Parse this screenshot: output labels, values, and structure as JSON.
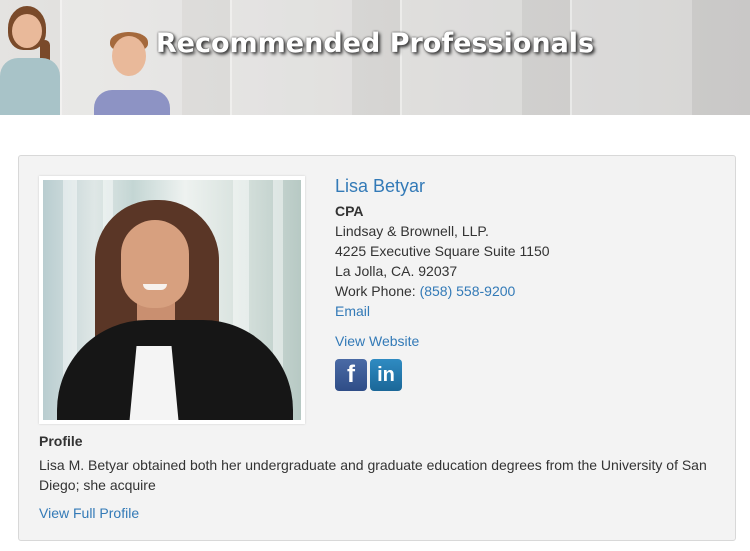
{
  "banner": {
    "title": "Recommended Professionals"
  },
  "professional": {
    "name": "Lisa Betyar",
    "designation": "CPA",
    "company": "Lindsay & Brownell, LLP.",
    "address_line1": "4225 Executive Square Suite 1150",
    "address_line2": "La Jolla, CA. 92037",
    "phone_label": "Work Phone:",
    "phone": "(858) 558-9200",
    "email_label": "Email",
    "website_label": "View Website",
    "social": {
      "facebook_glyph": "f",
      "linkedin_glyph": "in"
    },
    "profile_heading": "Profile",
    "profile_text": "Lisa M. Betyar obtained both her undergraduate and graduate education degrees from the University of San Diego; she acquire",
    "full_profile_label": "View Full Profile"
  },
  "colors": {
    "link": "#337ab7",
    "card_bg": "#f3f3f3",
    "facebook": "#3b5998",
    "linkedin": "#1b6798"
  }
}
